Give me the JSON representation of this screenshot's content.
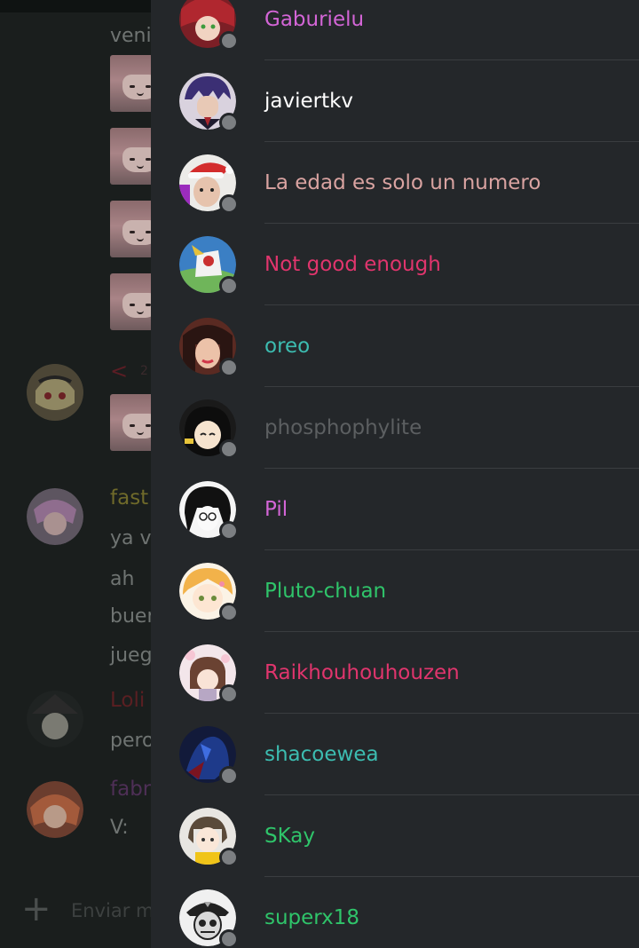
{
  "background_chat": {
    "top_partial_message": "veni",
    "reply_arrow": "<",
    "reply_meta": "2",
    "users": [
      {
        "name": "fast",
        "color": "#6f6a2a"
      },
      {
        "name": "Loli",
        "color": "#5a1f22"
      },
      {
        "name": "fabr",
        "color": "#4e2f56"
      }
    ],
    "messages": [
      "ya v",
      "ah",
      "buer",
      "jueg",
      "pero",
      "V:"
    ],
    "composer_plus": "+",
    "composer_placeholder": "Enviar m"
  },
  "members": [
    {
      "name": "Gaburielu",
      "color": "#d365d6",
      "status": "offline"
    },
    {
      "name": "javiertkv",
      "color": "#ffffff",
      "status": "offline"
    },
    {
      "name": "La edad es solo un numero",
      "color": "#d9a3a1",
      "status": "offline"
    },
    {
      "name": "Not good enough",
      "color": "#e0356d",
      "status": "offline"
    },
    {
      "name": "oreo",
      "color": "#3cbcb0",
      "status": "offline"
    },
    {
      "name": "phosphophylite",
      "color": "#5c5f61",
      "status": "offline"
    },
    {
      "name": "Pil",
      "color": "#d365d6",
      "status": "offline"
    },
    {
      "name": "Pluto-chuan",
      "color": "#2fc46a",
      "status": "offline"
    },
    {
      "name": "Raikhouhouhouzen",
      "color": "#e0356d",
      "status": "offline"
    },
    {
      "name": "shacoewea",
      "color": "#3cbcb0",
      "status": "offline"
    },
    {
      "name": "SKay",
      "color": "#2fc46a",
      "status": "offline"
    },
    {
      "name": "superx18",
      "color": "#2fc46a",
      "status": "offline"
    }
  ],
  "icons": {
    "status": "offline-status-dot-icon",
    "add": "plus-icon"
  }
}
